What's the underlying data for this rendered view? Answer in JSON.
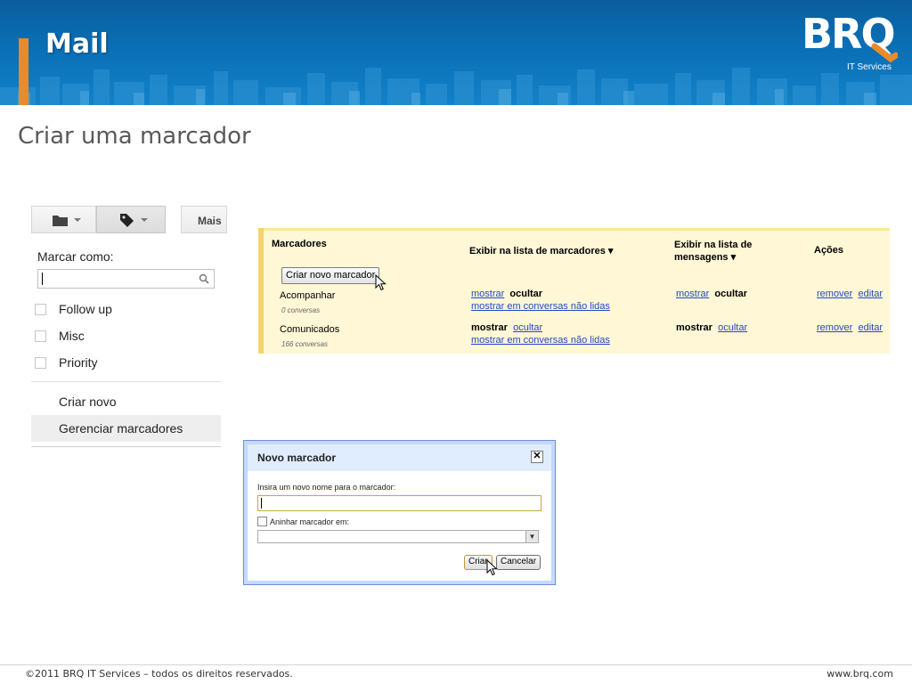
{
  "slide": {
    "title": "Mail",
    "subtitle": "Criar uma marcador",
    "logo_text": "BRQ",
    "logo_sub": "IT Services",
    "footer_left": "©2011 BRQ IT Services – todos os direitos reservados.",
    "footer_right": "www.brq.com",
    "colors": {
      "banner": "#0a6fb6",
      "accent": "#e98a2b"
    }
  },
  "label_menu": {
    "toolbar": {
      "folder_icon": "folder-icon",
      "label_icon": "tag-icon",
      "more": "Mais"
    },
    "heading": "Marcar como:",
    "search_placeholder": "",
    "labels": [
      "Follow up",
      "Misc",
      "Priority"
    ],
    "create": "Criar novo",
    "manage": "Gerenciar marcadores"
  },
  "labels_table": {
    "headers": {
      "labels": "Marcadores",
      "show_in_list": "Exibir na lista de marcadores",
      "show_in_messages_1": "Exibir na lista de",
      "show_in_messages_2": "mensagens",
      "actions": "Ações"
    },
    "new_label_button": "Criar novo marcador",
    "rows": [
      {
        "name": "Acompanhar",
        "count": "0 conversas",
        "list_show": "mostrar",
        "list_hide": "ocultar",
        "list_unread": "mostrar em conversas não lidas",
        "msg_show": "mostrar",
        "msg_hide": "ocultar",
        "remove": "remover",
        "edit": "editar"
      },
      {
        "name": "Comunicados",
        "count": "166 conversas",
        "list_show": "mostrar",
        "list_hide": "ocultar",
        "list_unread": "mostrar em conversas não lidas",
        "msg_show": "mostrar",
        "msg_hide": "ocultar",
        "remove": "remover",
        "edit": "editar"
      }
    ]
  },
  "dialog": {
    "title": "Novo marcador",
    "close": "✕",
    "name_label": "Insira um novo nome para o marcador:",
    "name_value": "",
    "nest_label": "Aninhar marcador em:",
    "nest_selected": "",
    "create_button": "Criar",
    "cancel_button": "Cancelar"
  }
}
